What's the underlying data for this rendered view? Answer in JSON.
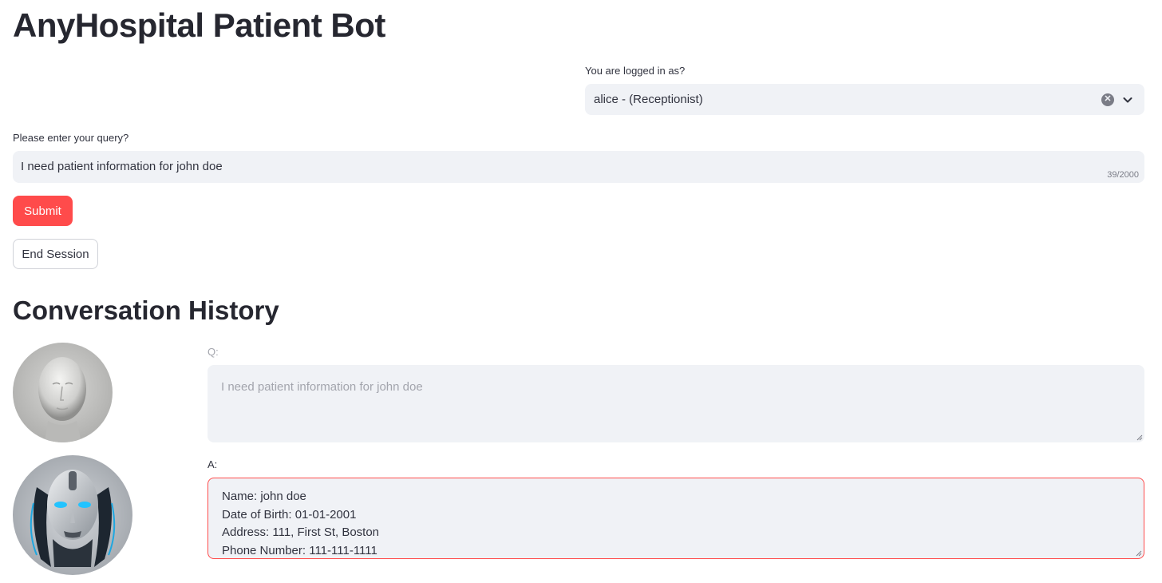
{
  "app": {
    "title": "AnyHospital Patient Bot"
  },
  "login": {
    "label": "You are logged in as?",
    "selected": "alice - (Receptionist)"
  },
  "query": {
    "label": "Please enter your query?",
    "value": "I need patient information for john doe",
    "char_count": "39/2000"
  },
  "buttons": {
    "submit": "Submit",
    "end_session": "End Session"
  },
  "history": {
    "title": "Conversation History",
    "q_label": "Q:",
    "q_text": "I need patient information for john doe",
    "a_label": "A:",
    "a_lines": [
      "Name: john doe",
      "Date of Birth: 01-01-2001",
      "Address: 111, First St, Boston",
      "Phone Number: 111-111-1111"
    ]
  },
  "icons": {
    "clear": "clear-icon",
    "chevron": "chevron-down-icon",
    "user_avatar": "mannequin-head-avatar",
    "bot_avatar": "robot-head-avatar"
  },
  "colors": {
    "accent": "#ff4b4b",
    "input_bg": "#f0f2f6",
    "text": "#31333f"
  }
}
